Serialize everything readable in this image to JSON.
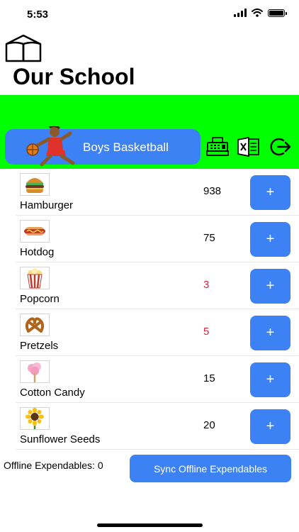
{
  "status_bar": {
    "time": "5:53"
  },
  "header": {
    "school_name": "Our School",
    "logo_icon": "open-book-icon"
  },
  "team": {
    "label": "Boys Basketball",
    "icon": "basketball-player-icon"
  },
  "toolbar": {
    "icons": [
      "cash-register-icon",
      "excel-icon",
      "logout-icon"
    ]
  },
  "colors": {
    "accent": "#3d82f4",
    "band": "#00ff00",
    "low_stock": "#d7263d"
  },
  "products": [
    {
      "name": "Hamburger",
      "quantity": "938",
      "icon": "hamburger-icon",
      "add_label": "+"
    },
    {
      "name": "Hotdog",
      "quantity": "75",
      "icon": "hotdog-icon",
      "add_label": "+"
    },
    {
      "name": "Popcorn",
      "quantity": "3",
      "icon": "popcorn-icon",
      "add_label": "+"
    },
    {
      "name": "Pretzels",
      "quantity": "5",
      "icon": "pretzel-icon",
      "add_label": "+"
    },
    {
      "name": "Cotton Candy",
      "quantity": "15",
      "icon": "cotton-candy-icon",
      "add_label": "+"
    },
    {
      "name": "Sunflower Seeds",
      "quantity": "20",
      "icon": "sunflower-icon",
      "add_label": "+"
    }
  ],
  "footer": {
    "offline_label": "Offline Expendables: 0",
    "sync_label": "Sync Offline Expendables"
  }
}
